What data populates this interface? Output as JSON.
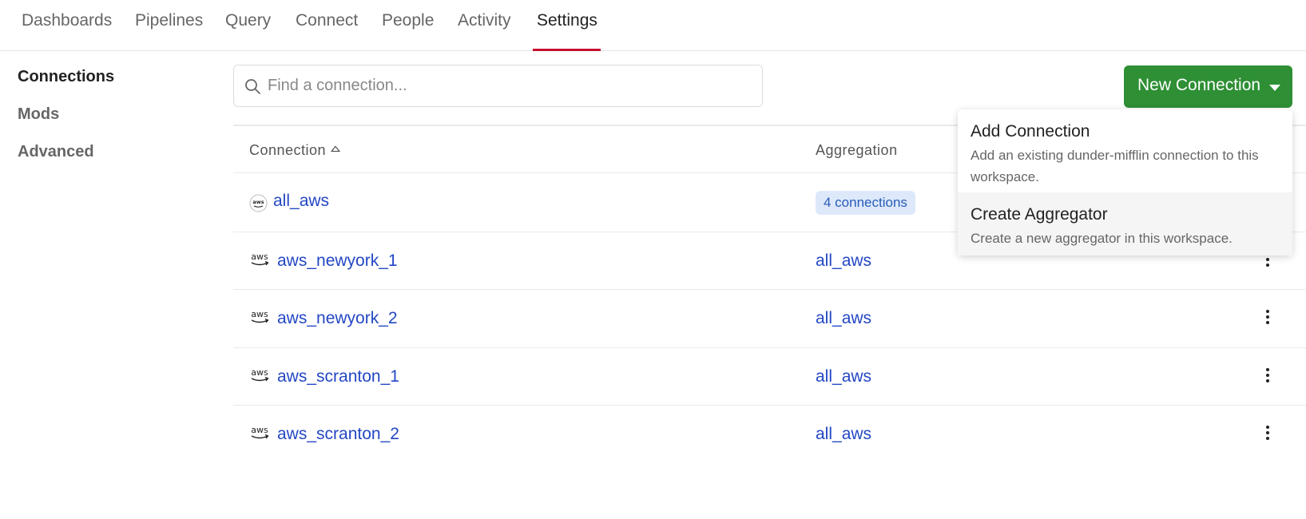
{
  "nav": {
    "tabs": [
      "Dashboards",
      "Pipelines",
      "Query",
      "Connect",
      "People",
      "Activity",
      "Settings"
    ],
    "active": "Settings"
  },
  "sidebar": {
    "items": [
      "Connections",
      "Mods",
      "Advanced"
    ],
    "active": "Connections"
  },
  "search": {
    "placeholder": "Find a connection...",
    "value": ""
  },
  "new_connection": {
    "label": "New Connection",
    "color": "#2e8f34"
  },
  "table": {
    "headers": [
      "Connection",
      "Aggregation"
    ],
    "rows": [
      {
        "icon": "aws-aggregator-icon",
        "name": "all_aws",
        "aggregation": "4 connections",
        "is_aggregator": true
      },
      {
        "icon": "aws-icon",
        "name": "aws_newyork_1",
        "aggregation": "all_aws",
        "is_aggregator": false
      },
      {
        "icon": "aws-icon",
        "name": "aws_newyork_2",
        "aggregation": "all_aws",
        "is_aggregator": false
      },
      {
        "icon": "aws-icon",
        "name": "aws_scranton_1",
        "aggregation": "all_aws",
        "is_aggregator": false
      },
      {
        "icon": "aws-icon",
        "name": "aws_scranton_2",
        "aggregation": "all_aws",
        "is_aggregator": false
      }
    ]
  },
  "menu": {
    "items": [
      {
        "title": "Add Connection",
        "description": "Add an existing dunder-mifflin connection to this workspace."
      },
      {
        "title": "Create Aggregator",
        "description": "Create a new aggregator in this workspace."
      }
    ]
  },
  "colors": {
    "accent_underline": "#c8102e",
    "link": "#2347c4",
    "badge_bg": "#dde9fb"
  }
}
